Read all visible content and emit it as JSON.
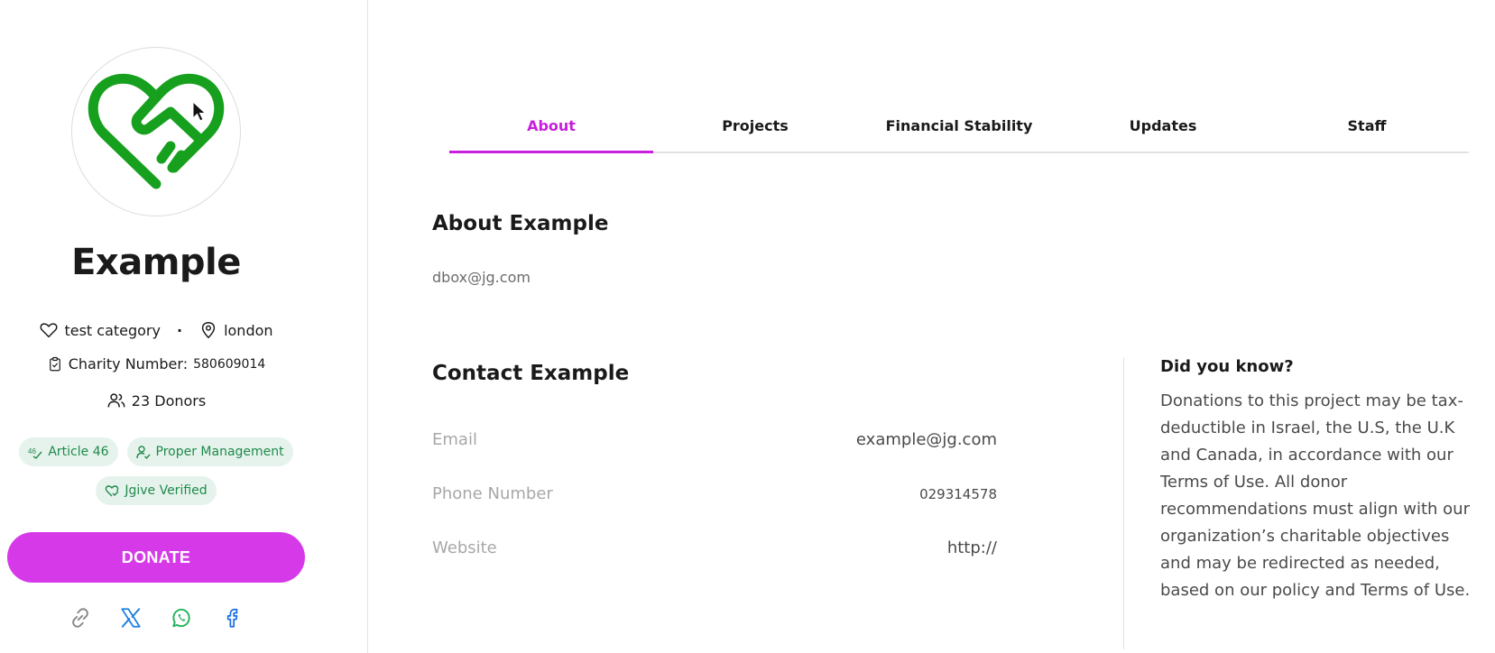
{
  "organization": {
    "name": "Example",
    "category": "test category",
    "location": "london",
    "charity_number_label": "Charity Number:",
    "charity_number": "580609014",
    "donors": "23 Donors",
    "logo_color": "#16a01e"
  },
  "badges": [
    {
      "label": "Article 46",
      "icon": "article-46-icon"
    },
    {
      "label": "Proper Management",
      "icon": "user-check-icon"
    },
    {
      "label": "Jgive Verified",
      "icon": "heart-check-icon"
    }
  ],
  "donate_label": "DONATE",
  "share_icons": [
    "link-icon",
    "x-icon",
    "whatsapp-icon",
    "facebook-icon"
  ],
  "tabs": [
    {
      "label": "About",
      "active": true
    },
    {
      "label": "Projects",
      "active": false
    },
    {
      "label": "Financial Stability",
      "active": false
    },
    {
      "label": "Updates",
      "active": false
    },
    {
      "label": "Staff",
      "active": false
    }
  ],
  "about": {
    "title": "About Example",
    "text": "dbox@jg.com"
  },
  "contact": {
    "title": "Contact Example",
    "rows": [
      {
        "label": "Email",
        "value": "example@jg.com"
      },
      {
        "label": "Phone Number",
        "value": "029314578"
      },
      {
        "label": "Website",
        "value": "http://"
      }
    ]
  },
  "did_you_know": {
    "title": "Did you know?",
    "text": "Donations to this project may be tax-deductible in Israel, the U.S, the U.K and Canada, in accordance with our Terms of Use. All donor recommendations must align with our organization’s charitable objectives and may be redirected as needed, based on our policy and Terms of Use."
  },
  "colors": {
    "accent": "#c91fe0",
    "donate": "#d63ae8",
    "badge_bg": "#e6f3ec",
    "badge_text": "#1f8a4c"
  }
}
